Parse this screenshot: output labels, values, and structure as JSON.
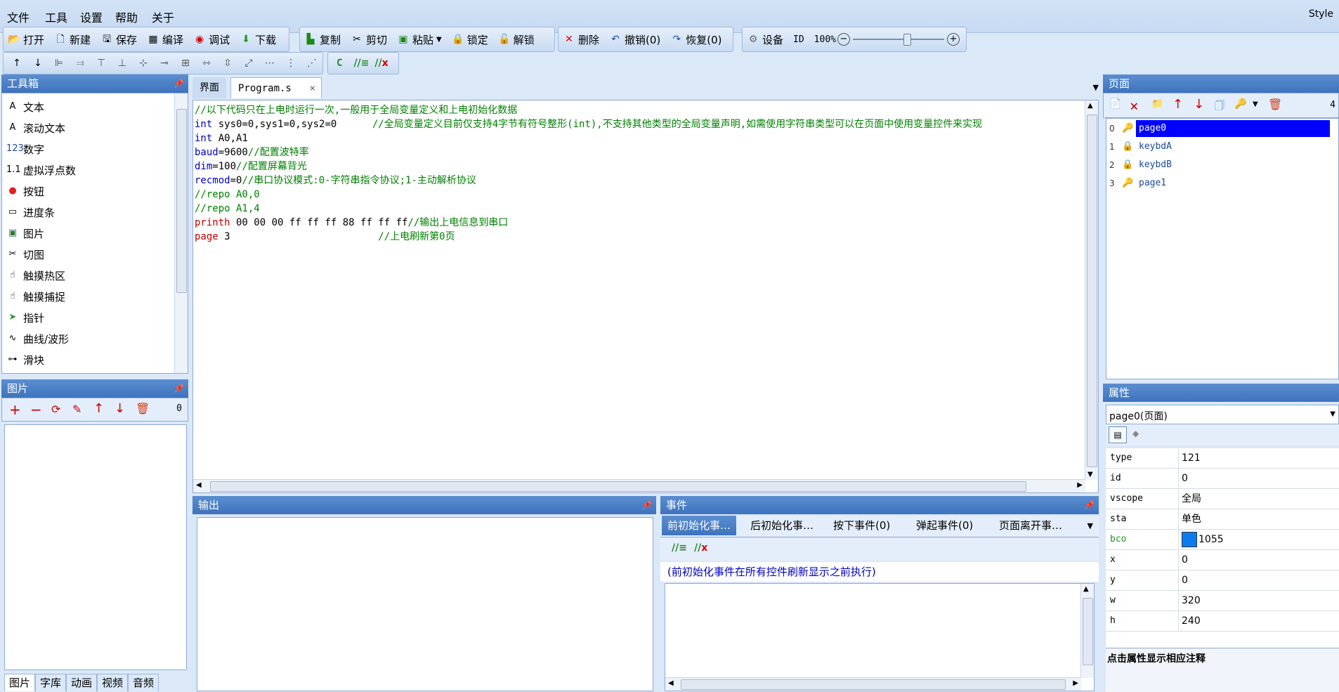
{
  "menu": {
    "items": [
      "文件",
      "工具",
      "设置",
      "帮助",
      "关于"
    ],
    "style_label": "Style"
  },
  "toolbar1": {
    "open": "打开",
    "new": "新建",
    "save": "保存",
    "compile": "编译",
    "debug": "调试",
    "download": "下载",
    "copy": "复制",
    "cut": "剪切",
    "paste": "粘贴",
    "lock": "锁定",
    "unlock": "解锁",
    "delete": "删除",
    "undo": "撤销(0)",
    "redo": "恢复(0)",
    "device": "设备",
    "id": "ID",
    "zoom": "100%"
  },
  "toolbar2": {
    "c_label": "C"
  },
  "toolbox": {
    "title": "工具箱",
    "items": [
      "文本",
      "滚动文本",
      "数字",
      "虚拟浮点数",
      "按钮",
      "进度条",
      "图片",
      "切图",
      "触摸热区",
      "触摸捕捉",
      "指针",
      "曲线/波形",
      "滑块"
    ],
    "icons": [
      "text-icon",
      "scroll-text-icon",
      "number-icon",
      "float-icon",
      "button-icon",
      "progress-icon",
      "picture-icon",
      "crop-icon",
      "touch-area-icon",
      "touch-capture-icon",
      "pointer-icon",
      "curve-icon",
      "slider-icon"
    ]
  },
  "pictures": {
    "title": "图片",
    "count": "0",
    "bottom_tabs": [
      "图片",
      "字库",
      "动画",
      "视频",
      "音频"
    ]
  },
  "editor": {
    "tabs": [
      "界面",
      "Program.s"
    ],
    "lines": [
      [
        {
          "t": "//以下代码只在上电时运行一次,一般用于全局变量定义和上电初始化数据",
          "c": "cm"
        }
      ],
      [
        {
          "t": "int",
          "c": "var"
        },
        {
          "t": " sys0=0,sys1=0,sys2=0      ",
          "c": ""
        },
        {
          "t": "//全局变量定义目前仅支持4字节有符号整形(int),不支持其他类型的全局变量声明,如需使用字符串类型可以在页面中使用变量控件来实现",
          "c": "cm"
        }
      ],
      [
        {
          "t": "int",
          "c": "var"
        },
        {
          "t": " A0,A1",
          "c": ""
        }
      ],
      [
        {
          "t": "baud",
          "c": "var"
        },
        {
          "t": "=9600",
          "c": ""
        },
        {
          "t": "//配置波特率",
          "c": "cm"
        }
      ],
      [
        {
          "t": "dim",
          "c": "var"
        },
        {
          "t": "=100",
          "c": ""
        },
        {
          "t": "//配置屏幕背光",
          "c": "cm"
        }
      ],
      [
        {
          "t": "recmod",
          "c": "var"
        },
        {
          "t": "=0",
          "c": ""
        },
        {
          "t": "//串口协议模式:0-字符串指令协议;1-主动解析协议",
          "c": "cm"
        }
      ],
      [
        {
          "t": "//repo A0,0",
          "c": "cm"
        }
      ],
      [
        {
          "t": "//repo A1,4",
          "c": "cm"
        }
      ],
      [
        {
          "t": "printh",
          "c": "kw"
        },
        {
          "t": " 00 00 00 ff ff ff 88 ff ff ff",
          "c": ""
        },
        {
          "t": "//输出上电信息到串口",
          "c": "cm"
        }
      ],
      [
        {
          "t": "page",
          "c": "kw"
        },
        {
          "t": " 3                         ",
          "c": ""
        },
        {
          "t": "//上电刷新第0页",
          "c": "cm"
        }
      ]
    ]
  },
  "output": {
    "title": "输出"
  },
  "events": {
    "title": "事件",
    "tabs": [
      "前初始化事…",
      "后初始化事…",
      "按下事件(0)",
      "弹起事件(0)",
      "页面离开事…"
    ],
    "description": "(前初始化事件在所有控件刷新显示之前执行)"
  },
  "pages": {
    "title": "页面",
    "count": "4",
    "items": [
      {
        "index": "0",
        "name": "page0"
      },
      {
        "index": "1",
        "name": "keybdA"
      },
      {
        "index": "2",
        "name": "keybdB"
      },
      {
        "index": "3",
        "name": "page1"
      }
    ]
  },
  "properties": {
    "title": "属性",
    "selector": "page0(页面)",
    "rows": [
      {
        "key": "type",
        "value": "121"
      },
      {
        "key": "id",
        "value": "0"
      },
      {
        "key": "vscope",
        "value": "全局"
      },
      {
        "key": "sta",
        "value": "单色"
      },
      {
        "key": "bco",
        "value": "1055"
      },
      {
        "key": "x",
        "value": "0"
      },
      {
        "key": "y",
        "value": "0"
      },
      {
        "key": "w",
        "value": "320"
      },
      {
        "key": "h",
        "value": "240"
      }
    ],
    "hint": "点击属性显示相应注释",
    "bco_color": "#0a7cf0"
  },
  "colors": {
    "accent": "#3e73bd",
    "selected": "#0000ff"
  }
}
